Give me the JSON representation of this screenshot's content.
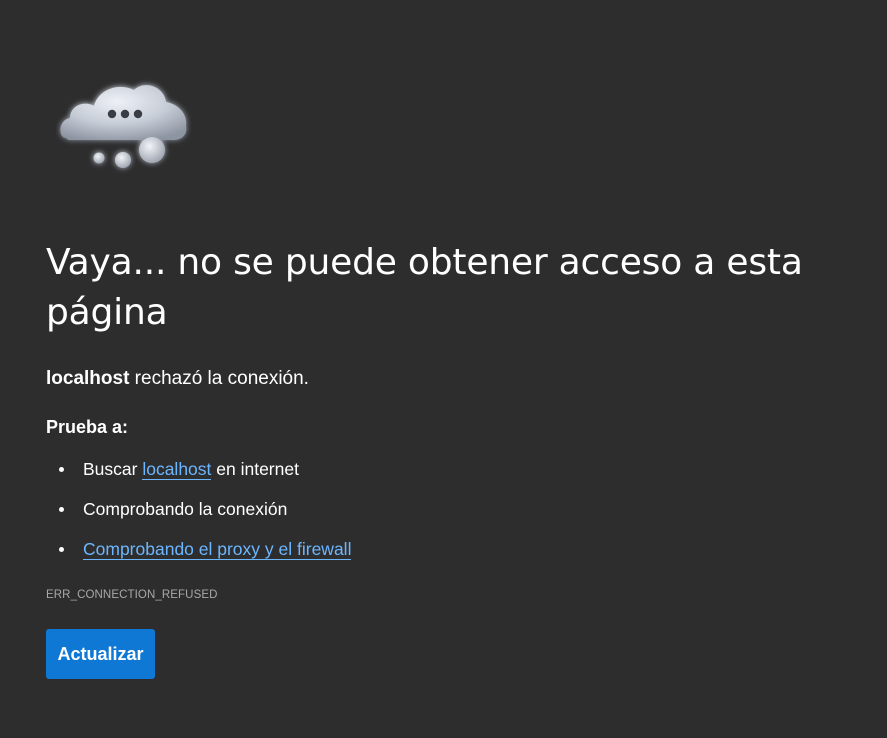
{
  "illustration": {
    "icon": "cloud-thinking-icon"
  },
  "page": {
    "title": "Vaya... no se puede obtener acceso a esta página",
    "host": "localhost",
    "reason_suffix": " rechazó la conexión.",
    "try_label": "Prueba a:",
    "suggestions": [
      {
        "prefix": "Buscar ",
        "link": "localhost",
        "suffix": " en internet"
      },
      {
        "text": "Comprobando la conexión"
      },
      {
        "link": "Comprobando el proxy y el firewall"
      }
    ],
    "error_code": "ERR_CONNECTION_REFUSED",
    "refresh_label": "Actualizar"
  },
  "colors": {
    "background": "#2d2d2e",
    "text": "#ffffff",
    "link": "#6cb6ff",
    "button": "#0f78d4",
    "error_code": "#a8a8a8"
  }
}
